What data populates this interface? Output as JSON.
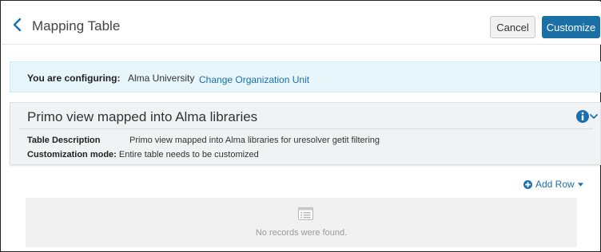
{
  "header": {
    "title": "Mapping Table",
    "back_icon": "chevron-left-icon",
    "cancel_label": "Cancel",
    "customize_label": "Customize"
  },
  "config": {
    "label": "You are configuring:",
    "value": "Alma University",
    "link": "Change Organization Unit"
  },
  "table_info": {
    "title": "Primo view mapped into Alma libraries",
    "toggle_icon": "info-icon",
    "description_label": "Table Description",
    "description_value": "Primo view mapped into Alma libraries for uresolver getit filtering",
    "mode_label": "Customization mode:",
    "mode_value": "Entire table needs to be customized"
  },
  "actions": {
    "add_row_label": "Add Row",
    "add_row_icon": "plus-circle-icon"
  },
  "empty_state": {
    "icon": "list-icon",
    "text": "No records were found."
  },
  "colors": {
    "primary": "#1b70a6",
    "link": "#1a6fb0",
    "config_bg": "#e7f6fb",
    "panel_bg": "#f0f2f3"
  }
}
